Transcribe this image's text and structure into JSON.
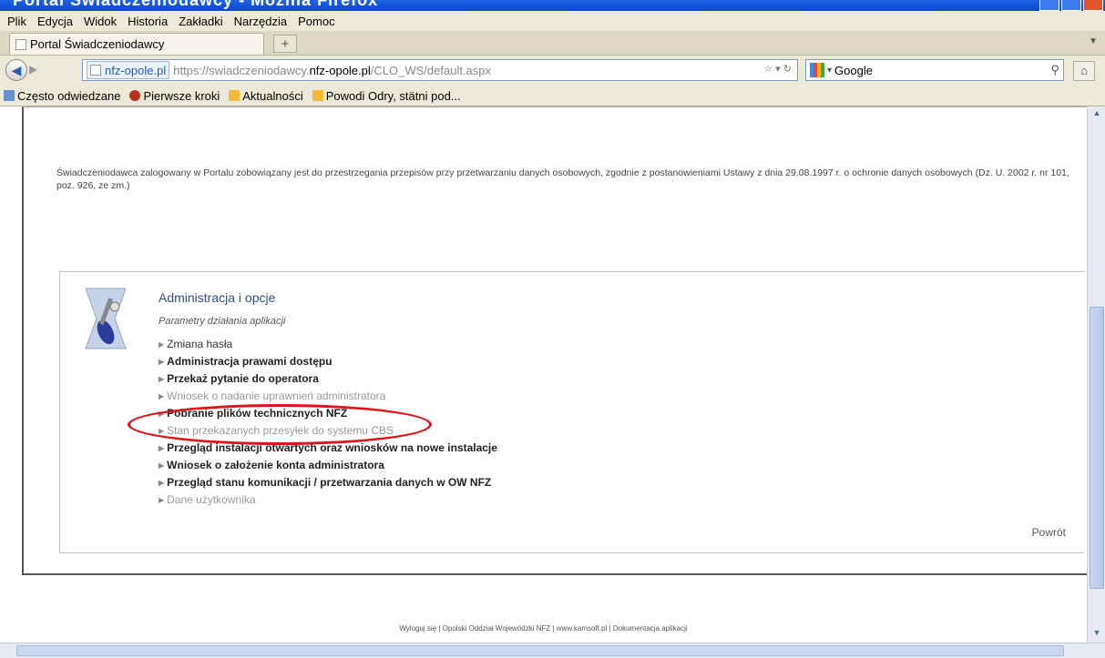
{
  "window": {
    "title": "Portal Świadczeniodawcy - Mozilla Firefox"
  },
  "menu": [
    "Plik",
    "Edycja",
    "Widok",
    "Historia",
    "Zakładki",
    "Narzędzia",
    "Pomoc"
  ],
  "tabs": [
    {
      "label": "Portal Świadczeniodawcy"
    }
  ],
  "newtab_label": "+",
  "nav": {
    "identity": "nfz-opole.pl",
    "url_prefix": "https://swiadczeniodawcy.",
    "url_domain": "nfz-opole.pl",
    "url_path": "/CLO_WS/default.aspx",
    "search_engine": "Google"
  },
  "bookmarks": [
    "Często odwiedzane",
    "Pierwsze kroki",
    "Aktualności",
    "Powodi Odry, stätni pod..."
  ],
  "disclaimer": "Świadczeniodawca zalogowany w Portalu zobowiązany jest do przestrzegania przepisów przy przetwarzaniu danych osobowych, zgodnie z postanowieniami Ustawy z dnia 29.08.1997 r. o ochronie danych osobowych (Dz. U. 2002 r. nr 101, poz. 926, ze zm.)",
  "panel": {
    "title": "Administracja i opcje",
    "subtitle": "Parametry działania aplikacji",
    "links": [
      {
        "label": "Zmiana hasła",
        "style": "normal"
      },
      {
        "label": "Administracja prawami dostępu",
        "style": "bold"
      },
      {
        "label": "Przekaż pytanie do operatora",
        "style": "bold"
      },
      {
        "label": "Wniosek o nadanie uprawnień administratora",
        "style": "muted"
      },
      {
        "label": "Pobranie plików technicznych NFZ",
        "style": "bold"
      },
      {
        "label": "Stan przekazanych przesyłek do systemu CBS",
        "style": "muted"
      },
      {
        "label": "Przegląd instalacji otwartych oraz wniosków na nowe instalacje",
        "style": "bold"
      },
      {
        "label": "Wniosek o założenie konta administratora",
        "style": "bold"
      },
      {
        "label": "Przegląd stanu komunikacji / przetwarzania danych w OW NFZ",
        "style": "bold"
      },
      {
        "label": "Dane użytkownika",
        "style": "muted"
      }
    ],
    "back": "Powrót"
  },
  "footer": "Wyloguj się | Opolski Oddział Wojewódzki NFZ | www.kamsoft.pl | Dokumentacja aplikacji",
  "colors": {
    "highlight": "#e0141b",
    "title_link": "#2e4f8a"
  }
}
